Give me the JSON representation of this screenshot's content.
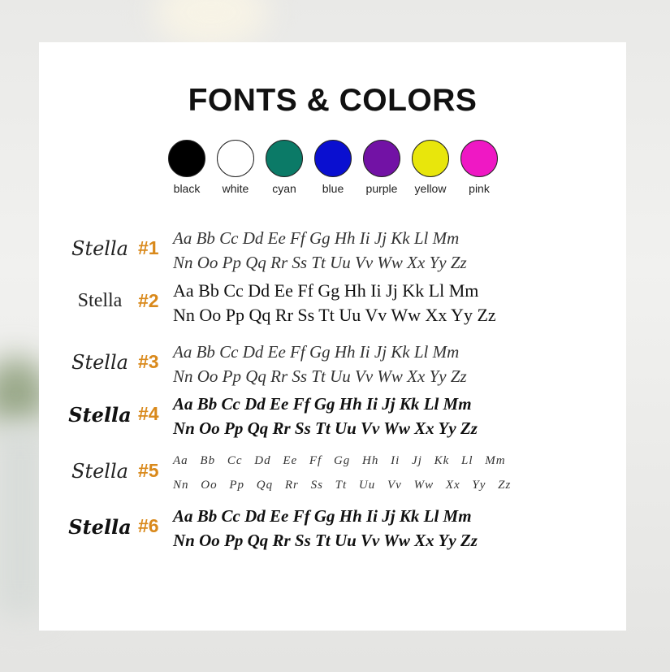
{
  "title": "FONTS & COLORS",
  "colors": [
    {
      "label": "black",
      "hex": "#000000"
    },
    {
      "label": "white",
      "hex": "#ffffff"
    },
    {
      "label": "cyan",
      "hex": "#0b7a67"
    },
    {
      "label": "blue",
      "hex": "#0a0fd0"
    },
    {
      "label": "purple",
      "hex": "#7212a5"
    },
    {
      "label": "yellow",
      "hex": "#e8e60c"
    },
    {
      "label": "pink",
      "hex": "#ef18c4"
    }
  ],
  "accent_color": "#d9891b",
  "fonts": [
    {
      "name": "Stella",
      "number": "#1",
      "line1": "Aa Bb Cc Dd Ee Ff Gg Hh Ii Jj Kk Ll Mm",
      "line2": "Nn Oo Pp Qq Rr Ss Tt Uu Vv Ww Xx Yy Zz"
    },
    {
      "name": "Stella",
      "number": "#2",
      "line1": "Aa Bb Cc Dd Ee Ff Gg Hh Ii Jj Kk Ll Mm",
      "line2": "Nn Oo Pp Qq Rr Ss Tt Uu Vv Ww Xx Yy Zz"
    },
    {
      "name": "Stella",
      "number": "#3",
      "line1": "Aa Bb Cc Dd Ee Ff Gg Hh Ii Jj Kk Ll Mm",
      "line2": "Nn Oo Pp Qq Rr Ss Tt Uu Vv Ww Xx Yy Zz"
    },
    {
      "name": "Stella",
      "number": "#4",
      "line1": "Aa Bb Cc Dd Ee Ff Gg Hh Ii Jj Kk Ll Mm",
      "line2": "Nn Oo Pp Qq Rr Ss Tt Uu Vv Ww Xx Yy Zz"
    },
    {
      "name": "Stella",
      "number": "#5",
      "line1": "Aa Bb Cc Dd Ee Ff Gg Hh Ii Jj Kk Ll Mm",
      "line2": "Nn Oo Pp Qq Rr Ss Tt Uu Vv Ww Xx Yy Zz"
    },
    {
      "name": "Stella",
      "number": "#6",
      "line1": "Aa Bb Cc Dd Ee Ff Gg Hh Ii Jj Kk Ll Mm",
      "line2": "Nn Oo Pp Qq Rr Ss Tt Uu Vv Ww Xx Yy Zz"
    }
  ]
}
